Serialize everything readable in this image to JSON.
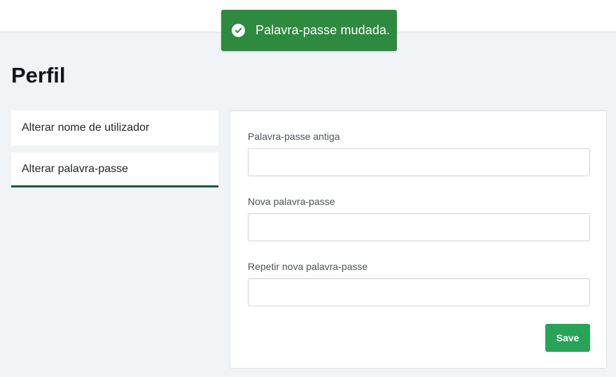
{
  "toast": {
    "icon": "check-circle-icon",
    "message": "Palavra-passe mudada.",
    "color": "#2d8a3f"
  },
  "page": {
    "title": "Perfil"
  },
  "tabs": [
    {
      "label": "Alterar nome de utilizador",
      "active": false
    },
    {
      "label": "Alterar palavra-passe",
      "active": true
    }
  ],
  "form": {
    "fields": [
      {
        "label": "Palavra-passe antiga",
        "value": ""
      },
      {
        "label": "Nova palavra-passe",
        "value": ""
      },
      {
        "label": "Repetir nova palavra-passe",
        "value": ""
      }
    ],
    "save_label": "Save",
    "save_color": "#27a458"
  },
  "colors": {
    "active_tab_underline": "#14593a",
    "background": "#f1f4f7"
  }
}
